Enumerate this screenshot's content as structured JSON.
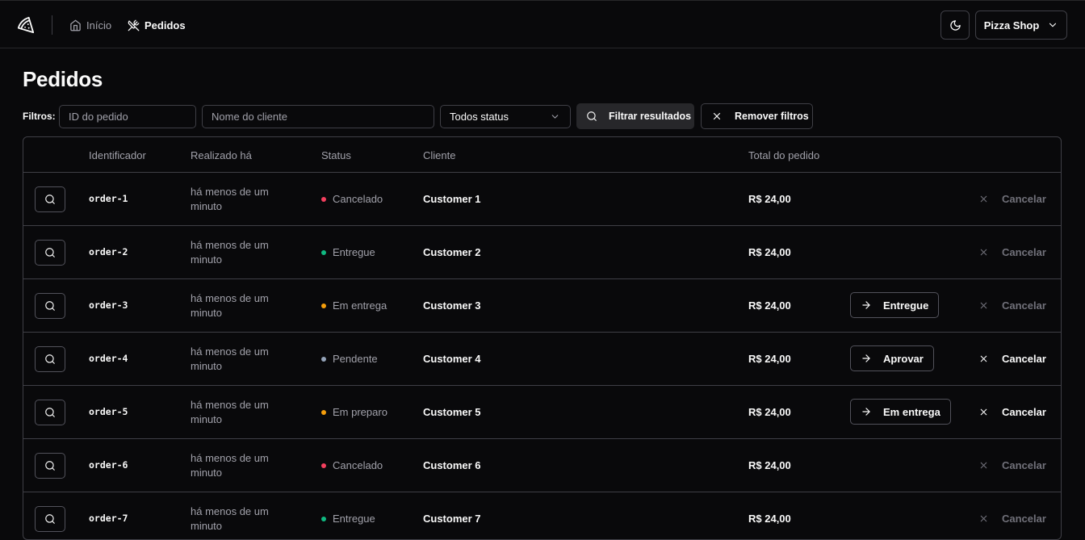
{
  "header": {
    "nav": [
      {
        "label": "Início",
        "icon": "home-icon",
        "active": false
      },
      {
        "label": "Pedidos",
        "icon": "utensils-icon",
        "active": true
      }
    ],
    "theme_toggle_icon": "moon-icon",
    "store_menu": {
      "label": "Pizza Shop",
      "icon": "chevron-down-icon"
    }
  },
  "page": {
    "title": "Pedidos"
  },
  "filters": {
    "label": "Filtros:",
    "order_id_placeholder": "ID do pedido",
    "customer_placeholder": "Nome do cliente",
    "status_selected": "Todos status",
    "apply_label": "Filtrar resultados",
    "clear_label": "Remover filtros"
  },
  "table": {
    "columns": [
      "",
      "Identificador",
      "Realizado há",
      "Status",
      "Cliente",
      "Total do pedido"
    ],
    "rows": [
      {
        "id": "order-1",
        "placed": "há menos de um minuto",
        "status": "Cancelado",
        "status_color": "#f43f5e",
        "customer": "Customer 1",
        "total": "R$ 24,00",
        "action": "",
        "cancel": "Cancelar",
        "cancel_enabled": false
      },
      {
        "id": "order-2",
        "placed": "há menos de um minuto",
        "status": "Entregue",
        "status_color": "#10b981",
        "customer": "Customer 2",
        "total": "R$ 24,00",
        "action": "",
        "cancel": "Cancelar",
        "cancel_enabled": false
      },
      {
        "id": "order-3",
        "placed": "há menos de um minuto",
        "status": "Em entrega",
        "status_color": "#f59e0b",
        "customer": "Customer 3",
        "total": "R$ 24,00",
        "action": "Entregue",
        "cancel": "Cancelar",
        "cancel_enabled": false
      },
      {
        "id": "order-4",
        "placed": "há menos de um minuto",
        "status": "Pendente",
        "status_color": "#94a3b8",
        "customer": "Customer 4",
        "total": "R$ 24,00",
        "action": "Aprovar",
        "cancel": "Cancelar",
        "cancel_enabled": true
      },
      {
        "id": "order-5",
        "placed": "há menos de um minuto",
        "status": "Em preparo",
        "status_color": "#f59e0b",
        "customer": "Customer 5",
        "total": "R$ 24,00",
        "action": "Em entrega",
        "cancel": "Cancelar",
        "cancel_enabled": true
      },
      {
        "id": "order-6",
        "placed": "há menos de um minuto",
        "status": "Cancelado",
        "status_color": "#f43f5e",
        "customer": "Customer 6",
        "total": "R$ 24,00",
        "action": "",
        "cancel": "Cancelar",
        "cancel_enabled": false
      },
      {
        "id": "order-7",
        "placed": "há menos de um minuto",
        "status": "Entregue",
        "status_color": "#10b981",
        "customer": "Customer 7",
        "total": "R$ 24,00",
        "action": "",
        "cancel": "Cancelar",
        "cancel_enabled": false
      }
    ]
  }
}
